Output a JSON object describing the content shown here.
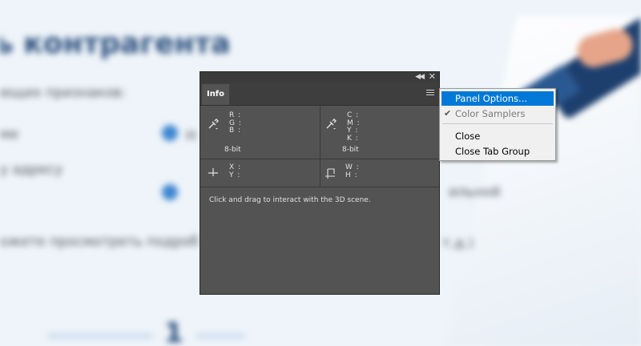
{
  "background": {
    "title": "ь контрагента",
    "lines": [
      "ющих признаков:",
      "ме",
      "у адресу",
      "ожете просмотреть подроб",
      "Н",
      "ильной",
      "т.д.)"
    ],
    "number": "1"
  },
  "panel": {
    "tab_label": "Info",
    "rgb_labels": "R :\nG :\nB :",
    "cmyk_labels": "C :\nM :\nY :\nK :",
    "left_bit": "8-bit",
    "right_bit": "8-bit",
    "xy_labels": "X :\nY :",
    "wh_labels": "W :\nH :",
    "info_text": "Click and drag to interact with the 3D scene."
  },
  "menu": {
    "items": [
      {
        "label": "Panel Options...",
        "state": "highlighted"
      },
      {
        "label": "Color Samplers",
        "state": "checked-disabled"
      },
      {
        "label": "Close",
        "state": "normal"
      },
      {
        "label": "Close Tab Group",
        "state": "normal"
      }
    ]
  },
  "colors": {
    "panel_bg": "#535353",
    "titlebar": "#3b3b3b",
    "menu_highlight": "#0078d7",
    "bg_accent": "#2b4f7e"
  },
  "icons": [
    "eyedropper-icon",
    "eyedropper-icon",
    "crosshair-icon",
    "selection-size-icon",
    "collapse-icon",
    "close-icon",
    "panel-menu-icon",
    "checkmark-icon"
  ]
}
